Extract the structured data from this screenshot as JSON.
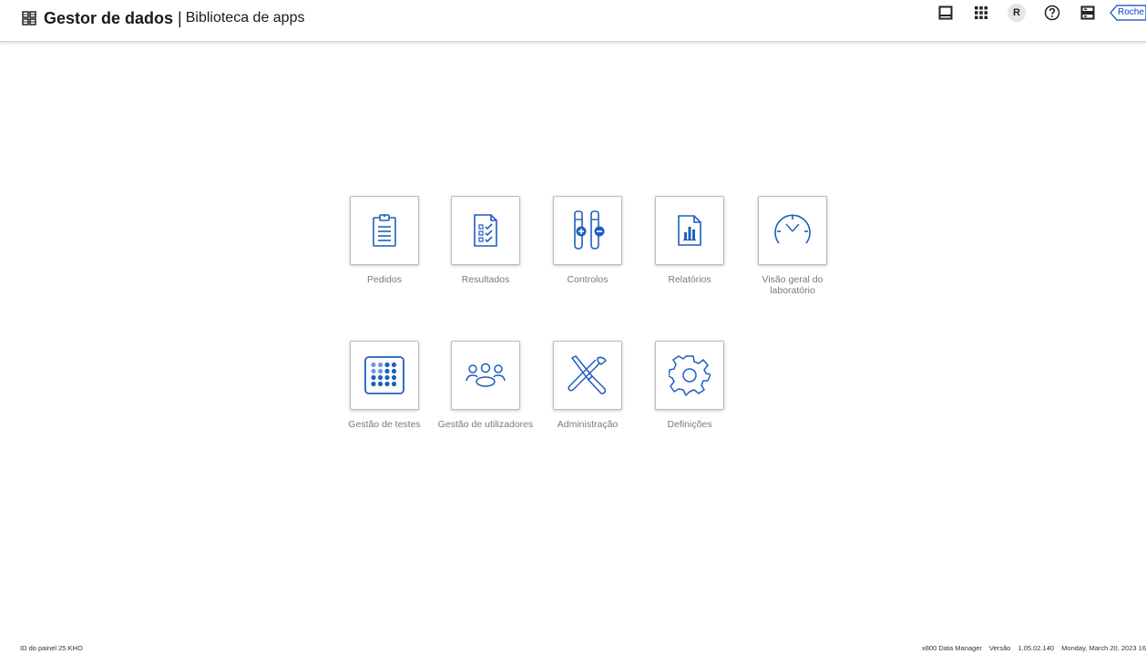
{
  "header": {
    "app_title": "Gestor de dados",
    "separator": "|",
    "app_subtitle": "Biblioteca de apps",
    "avatar_initial": "R",
    "brand": "Roche",
    "icons": [
      "app-grid-icon",
      "inbox-icon",
      "apps-grid-icon",
      "help-icon",
      "server-icon"
    ]
  },
  "tiles": [
    {
      "label": "Pedidos",
      "icon": "clipboard-icon"
    },
    {
      "label": "Resultados",
      "icon": "checklist-icon"
    },
    {
      "label": "Controlos",
      "icon": "test-tubes-icon"
    },
    {
      "label": "Relatórios",
      "icon": "report-chart-icon"
    },
    {
      "label": "Visão geral do laboratório",
      "icon": "gauge-icon"
    },
    {
      "label": "Gestão de testes",
      "icon": "test-grid-icon"
    },
    {
      "label": "Gestão de utilizadores",
      "icon": "users-icon"
    },
    {
      "label": "Administração",
      "icon": "tools-icon"
    },
    {
      "label": "Definições",
      "icon": "gear-icon"
    }
  ],
  "footer": {
    "panel_id": "ID do painel 25.KHO",
    "product": "x800 Data Manager",
    "version_label": "Versão",
    "version": "1.05.02.140",
    "datetime": "Monday, March 20, 2023 16"
  },
  "colors": {
    "accent": "#0b41cd",
    "icon_blue": "#1f5fbf",
    "label_gray": "#7a7a7a",
    "tile_border": "#b7bcc2"
  }
}
